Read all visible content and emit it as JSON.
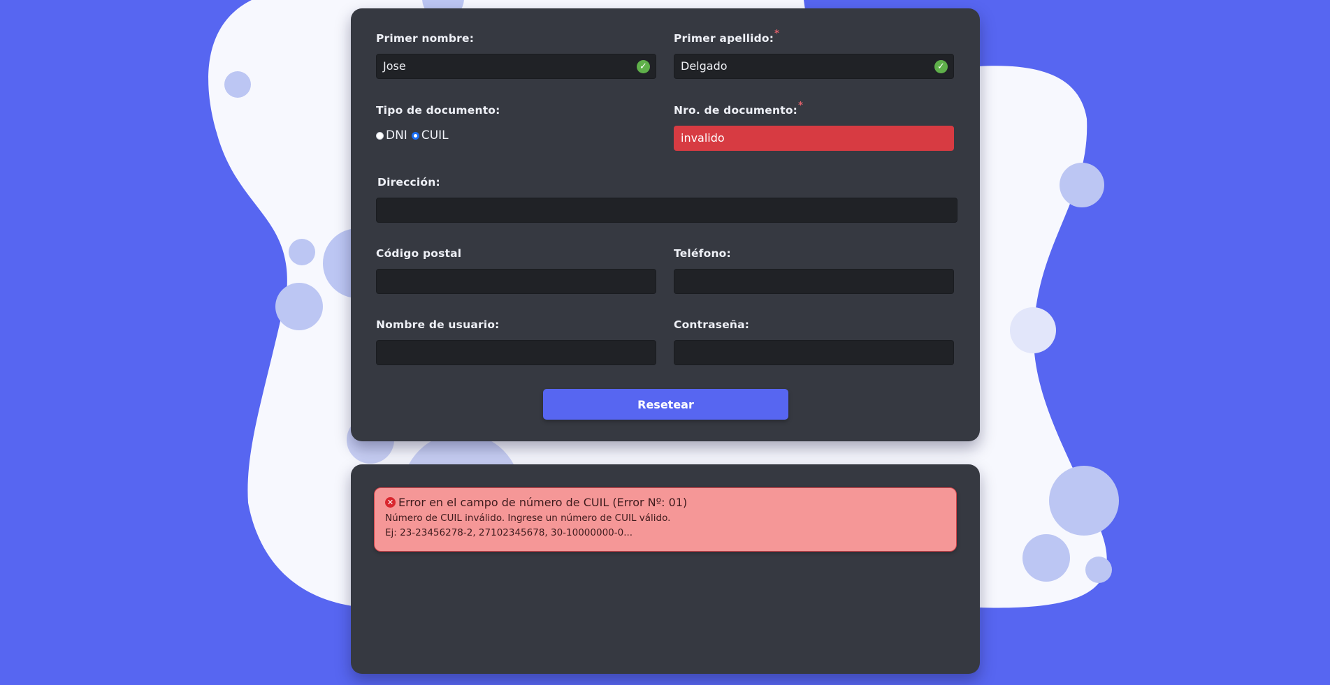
{
  "form": {
    "first_name": {
      "label": "Primer nombre:",
      "value": "Jose",
      "valid": true
    },
    "last_name": {
      "label": "Primer apellido:",
      "required_mark": "*",
      "value": "Delgado",
      "valid": true
    },
    "doc_type": {
      "label": "Tipo de documento:",
      "options": [
        "DNI",
        "CUIL"
      ],
      "selected": "CUIL"
    },
    "doc_number": {
      "label": "Nro. de documento:",
      "required_mark": "*",
      "value": "invalido",
      "valid": false
    },
    "address": {
      "label": "Dirección:",
      "value": ""
    },
    "postal_code": {
      "label": "Código postal",
      "value": ""
    },
    "phone": {
      "label": "Teléfono:",
      "value": ""
    },
    "username": {
      "label": "Nombre de usuario:",
      "value": ""
    },
    "password": {
      "label": "Contraseña:",
      "value": ""
    },
    "reset_label": "Resetear"
  },
  "error": {
    "title": "Error en el campo de número de CUIL (Error Nº: 01)",
    "message": "Número de CUIL inválido. Ingrese un número de CUIL válido.",
    "example": "Ej: 23-23456278-2, 27102345678, 30-10000000-0..."
  },
  "colors": {
    "background": "#5766f1",
    "card": "#363941",
    "input": "#202226",
    "invalid": "#d73b42",
    "valid_check": "#5fb04a",
    "accent": "#5766f1",
    "alert_bg": "#f59797"
  },
  "icons": {
    "valid": "check-circle-icon",
    "error": "x-circle-icon"
  }
}
